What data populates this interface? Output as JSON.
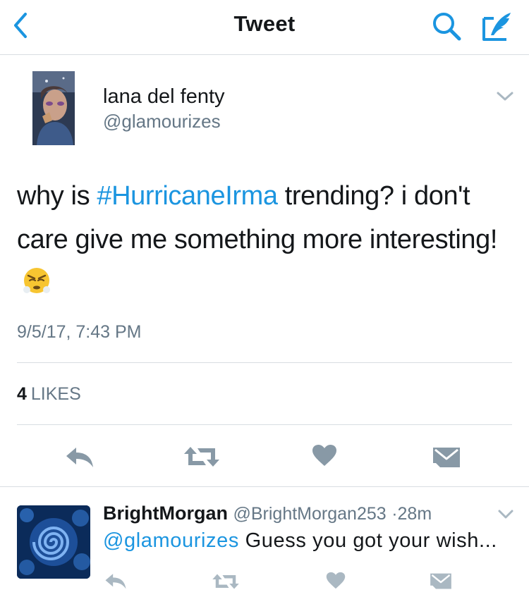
{
  "navbar": {
    "title": "Tweet",
    "back_icon": "chevron-left-icon",
    "search_icon": "search-icon",
    "compose_icon": "compose-quill-icon",
    "accent_color": "#1b95e0"
  },
  "main_tweet": {
    "author_name": "lana del fenty",
    "author_handle": "@glamourizes",
    "text_before": "why is ",
    "hashtag": "#HurricaneIrma",
    "text_after": " trending? i don't care give me something more interesting!",
    "emoji": "angry-face-emoji",
    "timestamp": "9/5/17, 7:43 PM",
    "likes_count": "4",
    "likes_label": "LIKES",
    "actions": [
      "reply-icon",
      "retweet-icon",
      "heart-icon",
      "direct-message-icon"
    ]
  },
  "reply_tweet": {
    "author_name": "BrightMorgan",
    "author_handle": "@BrightMorgan253",
    "separator": "·",
    "time_ago": "28m",
    "mention": "@glamourizes",
    "text": " Guess you got your wish...",
    "actions": [
      "reply-icon",
      "retweet-icon",
      "heart-icon",
      "direct-message-icon"
    ]
  },
  "colors": {
    "text_primary": "#14171a",
    "text_secondary": "#657786",
    "link": "#1b95e0",
    "action_icon_main": "#8899a6",
    "action_icon_reply": "#aab8c2",
    "divider": "#d8dde2"
  }
}
